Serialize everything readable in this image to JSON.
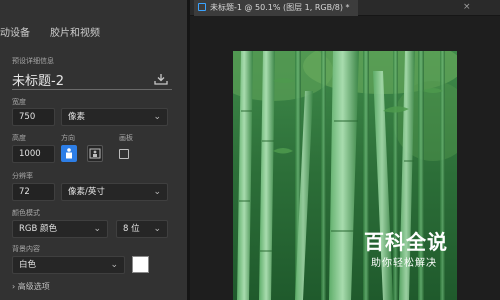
{
  "dialog": {
    "tabs": [
      "动设备",
      "胶片和视频"
    ],
    "preset_details_label": "预设详细信息",
    "doc_name": "未标题-2",
    "width_label": "宽度",
    "width_value": "750",
    "width_unit": "像素",
    "height_label": "高度",
    "height_value": "1000",
    "orientation_label": "方向",
    "artboard_label": "画板",
    "resolution_label": "分辨率",
    "resolution_value": "72",
    "resolution_unit": "像素/英寸",
    "color_mode_label": "颜色模式",
    "color_mode_value": "RGB 颜色",
    "bit_depth_value": "8 位",
    "background_label": "背景内容",
    "background_value": "白色",
    "background_color": "#ffffff",
    "advanced_label": "高级选项"
  },
  "document": {
    "tab_title": "未标题-1 @ 50.1% (图层 1, RGB/8) *",
    "close_label": "×"
  },
  "watermark": {
    "title": "百科全说",
    "subtitle": "助你轻松解决"
  }
}
